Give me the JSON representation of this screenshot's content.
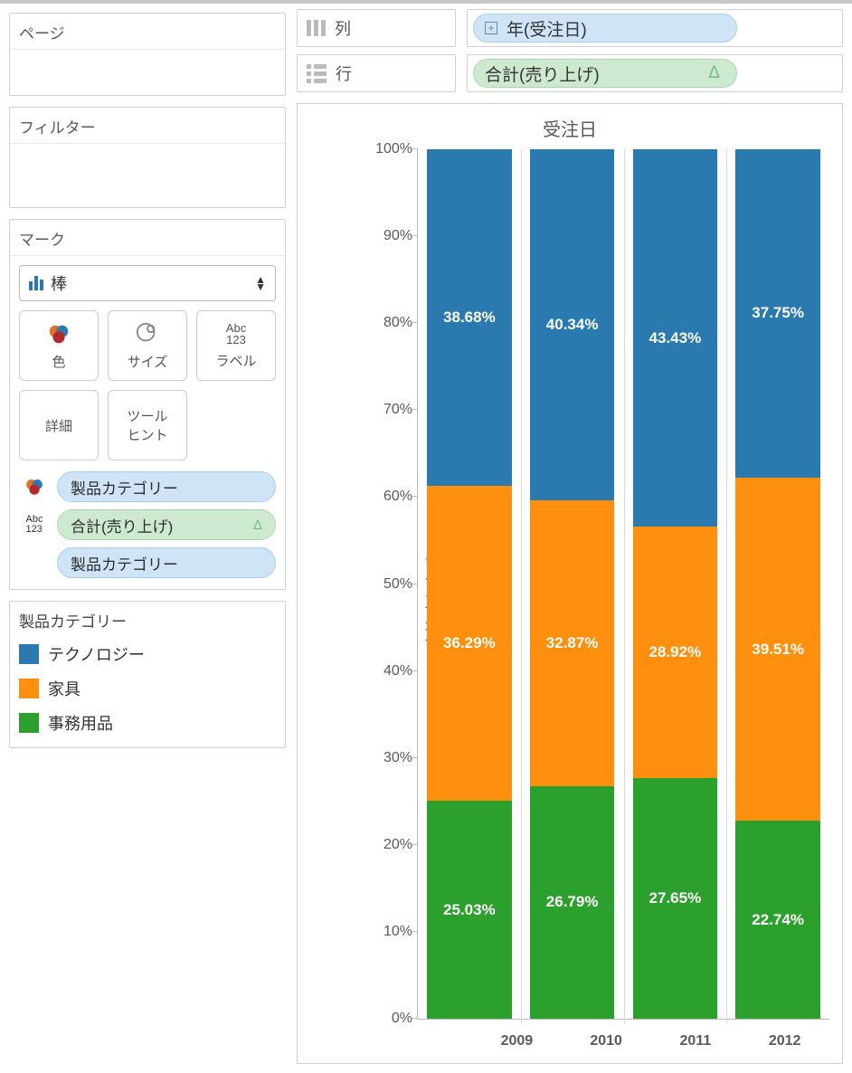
{
  "shelves": {
    "columns_label": "列",
    "rows_label": "行",
    "columns_pill": "年(受注日)",
    "rows_pill": "合計(売り上げ)",
    "delta": "Δ"
  },
  "cards": {
    "pages_title": "ページ",
    "filters_title": "フィルター",
    "marks_title": "マーク"
  },
  "marks": {
    "type_label": "棒",
    "color": "色",
    "size": "サイズ",
    "label": "ラベル",
    "detail": "詳細",
    "tooltip": "ツール\nヒント",
    "abc123": "Abc\n123",
    "pills": {
      "category_a": "製品カテゴリー",
      "sum_sales": "合計(売り上げ)",
      "category_b": "製品カテゴリー",
      "delta": "Δ"
    }
  },
  "legend": {
    "title": "製品カテゴリー",
    "items": [
      {
        "label": "テクノロジー",
        "color": "#2a7ab0"
      },
      {
        "label": "家具",
        "color": "#ff8f0e"
      },
      {
        "label": "事務用品",
        "color": "#2ca02c"
      }
    ]
  },
  "chart_data": {
    "type": "bar",
    "title": "受注日",
    "ylabel": "合計 売り上げ の %",
    "ylim": [
      0,
      100
    ],
    "yticks": [
      0,
      10,
      20,
      30,
      40,
      50,
      60,
      70,
      80,
      90,
      100
    ],
    "categories": [
      "2009",
      "2010",
      "2011",
      "2012"
    ],
    "series": [
      {
        "name": "テクノロジー",
        "color": "#2a7ab0",
        "values": [
          38.68,
          40.34,
          43.43,
          37.75
        ]
      },
      {
        "name": "家具",
        "color": "#ff8f0e",
        "values": [
          36.29,
          32.87,
          28.92,
          39.51
        ]
      },
      {
        "name": "事務用品",
        "color": "#2ca02c",
        "values": [
          25.03,
          26.79,
          27.65,
          22.74
        ]
      }
    ]
  }
}
